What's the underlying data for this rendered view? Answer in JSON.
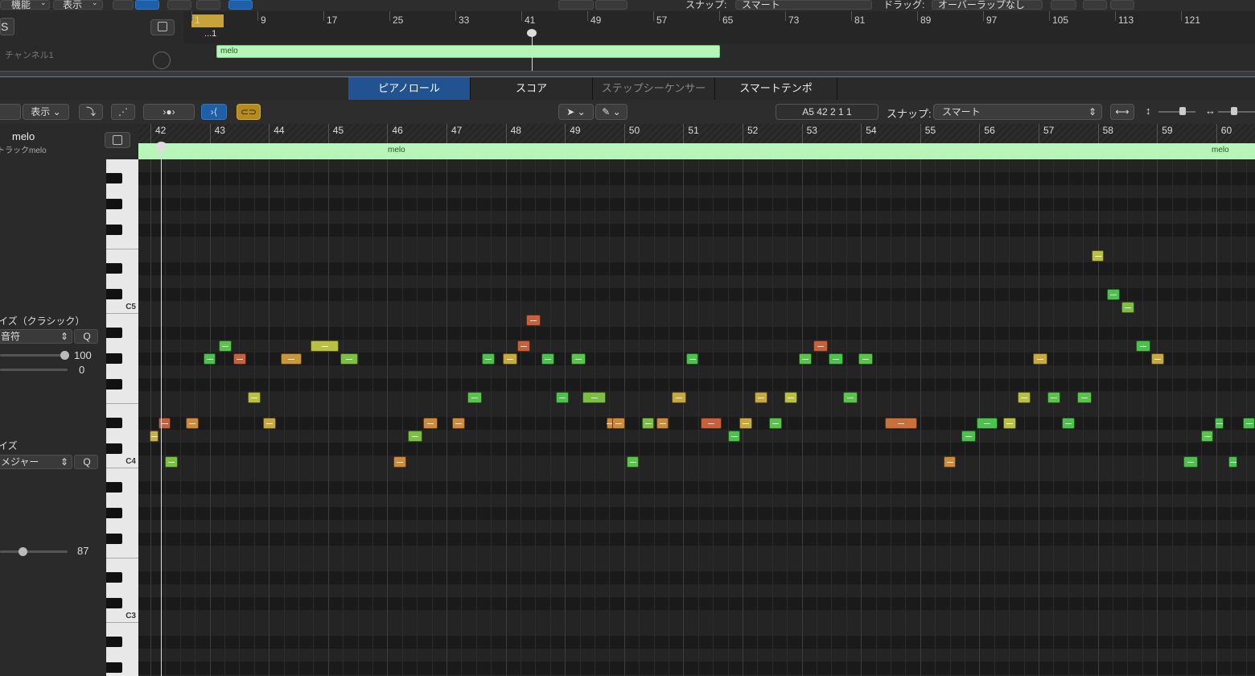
{
  "top_toolbar": {
    "edit_menu": "機能",
    "view_menu": "表示",
    "snap_label": "スナップ:",
    "snap_value": "スマート",
    "drag_label": "ドラッグ:",
    "drag_value": "オーバーラップなし"
  },
  "top_tracks": {
    "track_name": "チャンネル1",
    "header_letter": "S",
    "ruler_bars": [
      "1",
      "9",
      "17",
      "25",
      "33",
      "41",
      "49",
      "57",
      "65",
      "73",
      "81",
      "89",
      "97",
      "105",
      "113",
      "121"
    ],
    "sub_position": "...1",
    "region_name": "melo"
  },
  "tabs": [
    {
      "label": "ピアノロール",
      "active": true
    },
    {
      "label": "スコア",
      "active": false
    },
    {
      "label": "ステップシーケンサー",
      "active": false,
      "dim": true
    },
    {
      "label": "スマートテンポ",
      "active": false
    }
  ],
  "pr_toolbar": {
    "view_menu": "表示",
    "position_display": "A5   42 2 1 1",
    "snap_label": "スナップ:",
    "snap_value": "スマート"
  },
  "inspector": {
    "region_name": "melo",
    "track_subtitle": "トラックmelo",
    "quantize_title": "イズ（クラシック）",
    "quantize_value": "音符",
    "q_button": "Q",
    "strength_value": "100",
    "swing_value": "0",
    "scale_title": "イズ",
    "scale_value": "メジャー",
    "q_button2": "Q",
    "velocity_value": "87",
    "strength_fraction": 1.0,
    "velocity_fraction": 0.35
  },
  "piano": {
    "c_labels": [
      {
        "label": "C5",
        "midi": 72
      },
      {
        "label": "C4",
        "midi": 60
      },
      {
        "label": "C3",
        "midi": 48
      }
    ]
  },
  "piano_roll": {
    "first_bar": 42,
    "bars": [
      "42",
      "43",
      "44",
      "45",
      "46",
      "47",
      "48",
      "49",
      "50",
      "51",
      "52",
      "53",
      "54",
      "55",
      "56",
      "57",
      "58",
      "59",
      "60"
    ],
    "region_labels": [
      "melo",
      "melo"
    ],
    "top_midi": 83,
    "notes": [
      {
        "bar": 41.98,
        "len": 0.15,
        "midi": 62,
        "color": "#c6b04a"
      },
      {
        "bar": 42.13,
        "len": 0.2,
        "midi": 63,
        "color": "#c9603c"
      },
      {
        "bar": 42.25,
        "len": 0.22,
        "midi": 60,
        "color": "#7cc043"
      },
      {
        "bar": 42.6,
        "len": 0.22,
        "midi": 63,
        "color": "#d08a3c"
      },
      {
        "bar": 42.9,
        "len": 0.2,
        "midi": 68,
        "color": "#4cc24c"
      },
      {
        "bar": 43.15,
        "len": 0.22,
        "midi": 69,
        "color": "#59c44a"
      },
      {
        "bar": 43.4,
        "len": 0.22,
        "midi": 68,
        "color": "#c9603c"
      },
      {
        "bar": 43.65,
        "len": 0.22,
        "midi": 65,
        "color": "#b9c042"
      },
      {
        "bar": 43.9,
        "len": 0.22,
        "midi": 63,
        "color": "#c9a840"
      },
      {
        "bar": 44.2,
        "len": 0.35,
        "midi": 68,
        "color": "#c9963c"
      },
      {
        "bar": 44.7,
        "len": 0.48,
        "midi": 69,
        "color": "#b9c042"
      },
      {
        "bar": 45.2,
        "len": 0.3,
        "midi": 68,
        "color": "#7cc043"
      },
      {
        "bar": 46.1,
        "len": 0.22,
        "midi": 60,
        "color": "#d08a3c"
      },
      {
        "bar": 46.35,
        "len": 0.25,
        "midi": 62,
        "color": "#7cc043"
      },
      {
        "bar": 46.6,
        "len": 0.25,
        "midi": 63,
        "color": "#d08a3c"
      },
      {
        "bar": 47.1,
        "len": 0.22,
        "midi": 63,
        "color": "#d08a3c"
      },
      {
        "bar": 47.35,
        "len": 0.25,
        "midi": 65,
        "color": "#59c44a"
      },
      {
        "bar": 47.6,
        "len": 0.22,
        "midi": 68,
        "color": "#4cc24c"
      },
      {
        "bar": 47.95,
        "len": 0.25,
        "midi": 68,
        "color": "#c9a840"
      },
      {
        "bar": 48.2,
        "len": 0.22,
        "midi": 69,
        "color": "#c9603c"
      },
      {
        "bar": 48.35,
        "len": 0.25,
        "midi": 71,
        "color": "#c9603c"
      },
      {
        "bar": 48.6,
        "len": 0.22,
        "midi": 68,
        "color": "#4cc24c"
      },
      {
        "bar": 48.85,
        "len": 0.22,
        "midi": 65,
        "color": "#4cc24c"
      },
      {
        "bar": 49.1,
        "len": 0.25,
        "midi": 68,
        "color": "#59c44a"
      },
      {
        "bar": 49.3,
        "len": 0.4,
        "midi": 65,
        "color": "#7cc043"
      },
      {
        "bar": 49.7,
        "len": 0.1,
        "midi": 63,
        "color": "#d08a3c"
      },
      {
        "bar": 49.8,
        "len": 0.22,
        "midi": 63,
        "color": "#d08a3c"
      },
      {
        "bar": 50.05,
        "len": 0.2,
        "midi": 60,
        "color": "#59c44a"
      },
      {
        "bar": 50.3,
        "len": 0.2,
        "midi": 63,
        "color": "#7cc043"
      },
      {
        "bar": 50.55,
        "len": 0.2,
        "midi": 63,
        "color": "#d08a3c"
      },
      {
        "bar": 50.8,
        "len": 0.25,
        "midi": 65,
        "color": "#c9a840"
      },
      {
        "bar": 51.05,
        "len": 0.2,
        "midi": 68,
        "color": "#4cc24c"
      },
      {
        "bar": 51.3,
        "len": 0.35,
        "midi": 63,
        "color": "#c9603c"
      },
      {
        "bar": 51.75,
        "len": 0.2,
        "midi": 62,
        "color": "#4cc24c"
      },
      {
        "bar": 51.95,
        "len": 0.22,
        "midi": 63,
        "color": "#c9a840"
      },
      {
        "bar": 52.2,
        "len": 0.22,
        "midi": 65,
        "color": "#c9a840"
      },
      {
        "bar": 52.45,
        "len": 0.22,
        "midi": 63,
        "color": "#59c44a"
      },
      {
        "bar": 52.7,
        "len": 0.22,
        "midi": 65,
        "color": "#b9c042"
      },
      {
        "bar": 52.95,
        "len": 0.22,
        "midi": 68,
        "color": "#59c44a"
      },
      {
        "bar": 53.2,
        "len": 0.25,
        "midi": 69,
        "color": "#c9603c"
      },
      {
        "bar": 53.45,
        "len": 0.25,
        "midi": 68,
        "color": "#4cc24c"
      },
      {
        "bar": 53.7,
        "len": 0.25,
        "midi": 65,
        "color": "#59c44a"
      },
      {
        "bar": 53.95,
        "len": 0.25,
        "midi": 68,
        "color": "#59c44a"
      },
      {
        "bar": 54.4,
        "len": 0.55,
        "midi": 63,
        "color": "#c9703c"
      },
      {
        "bar": 55.4,
        "len": 0.2,
        "midi": 60,
        "color": "#d08a3c"
      },
      {
        "bar": 55.7,
        "len": 0.25,
        "midi": 62,
        "color": "#4cc24c"
      },
      {
        "bar": 55.95,
        "len": 0.35,
        "midi": 63,
        "color": "#4cc24c"
      },
      {
        "bar": 56.4,
        "len": 0.22,
        "midi": 63,
        "color": "#b9c042"
      },
      {
        "bar": 56.65,
        "len": 0.22,
        "midi": 65,
        "color": "#b9c042"
      },
      {
        "bar": 56.9,
        "len": 0.25,
        "midi": 68,
        "color": "#c9a840"
      },
      {
        "bar": 57.15,
        "len": 0.22,
        "midi": 65,
        "color": "#59c44a"
      },
      {
        "bar": 57.4,
        "len": 0.22,
        "midi": 63,
        "color": "#4cc24c"
      },
      {
        "bar": 57.65,
        "len": 0.25,
        "midi": 65,
        "color": "#59c44a"
      },
      {
        "bar": 57.9,
        "len": 0.2,
        "midi": 76,
        "color": "#b9c042"
      },
      {
        "bar": 58.15,
        "len": 0.22,
        "midi": 73,
        "color": "#4cc24c"
      },
      {
        "bar": 58.4,
        "len": 0.22,
        "midi": 72,
        "color": "#7cc043"
      },
      {
        "bar": 58.65,
        "len": 0.25,
        "midi": 69,
        "color": "#4cc24c"
      },
      {
        "bar": 58.9,
        "len": 0.22,
        "midi": 68,
        "color": "#c9a840"
      },
      {
        "bar": 59.45,
        "len": 0.25,
        "midi": 60,
        "color": "#4cc24c"
      },
      {
        "bar": 59.75,
        "len": 0.2,
        "midi": 62,
        "color": "#59c44a"
      },
      {
        "bar": 59.98,
        "len": 0.15,
        "midi": 63,
        "color": "#4cc24c"
      },
      {
        "bar": 60.2,
        "len": 0.15,
        "midi": 60,
        "color": "#4cc24c"
      },
      {
        "bar": 60.45,
        "len": 0.2,
        "midi": 63,
        "color": "#4cc24c"
      }
    ]
  }
}
